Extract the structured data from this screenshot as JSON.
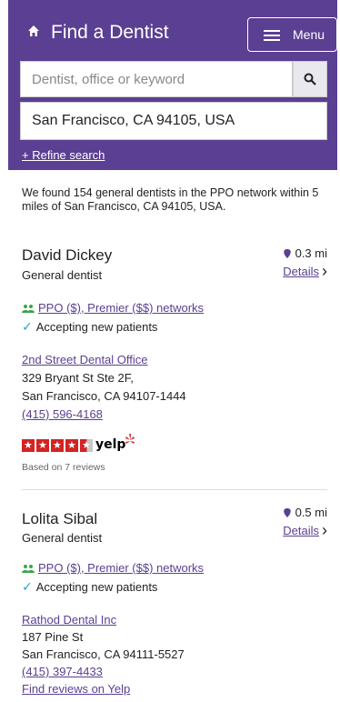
{
  "header": {
    "title": "Find a Dentist",
    "menu_label": "Menu",
    "accent": "#5b3f92"
  },
  "search": {
    "placeholder": "Dentist, office or keyword",
    "location_value": "San Francisco, CA 94105, USA",
    "refine_label": "+ Refine search"
  },
  "summary": "We found 154 general dentists in the PPO network within 5 miles of San Francisco, CA 94105, USA.",
  "results": [
    {
      "name": "David Dickey",
      "type": "General dentist",
      "distance": "0.3 mi",
      "details_label": "Details",
      "networks": "PPO ($), Premier ($$) networks",
      "accepting": "Accepting new patients",
      "office": "2nd Street Dental Office",
      "address1": "329 Bryant St Ste 2F,",
      "address2": "San Francisco, CA 94107-1444",
      "phone": "(415) 596-4168",
      "yelp": {
        "rating": 4.5,
        "logo_text": "yelp",
        "reviews": "Based on 7 reviews"
      }
    },
    {
      "name": "Lolita Sibal",
      "type": "General dentist",
      "distance": "0.5 mi",
      "details_label": "Details",
      "networks": "PPO ($), Premier ($$) networks",
      "accepting": "Accepting new patients",
      "office": "Rathod Dental Inc",
      "address1": "187 Pine St",
      "address2": "San Francisco, CA 94111-5527",
      "phone": "(415) 397-4433",
      "find_reviews": "Find reviews on Yelp"
    }
  ],
  "icons": [
    "home-icon",
    "menu-icon",
    "search-icon",
    "location-pin-icon",
    "chevron-right-icon",
    "network-people-icon",
    "check-icon",
    "yelp-star-icon",
    "yelp-burst-icon"
  ]
}
